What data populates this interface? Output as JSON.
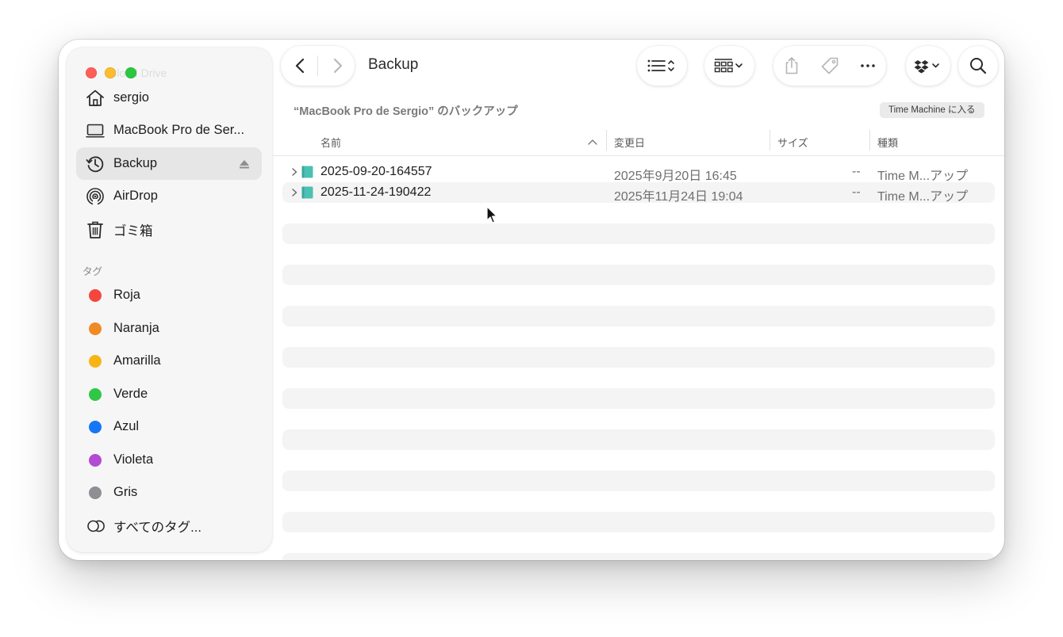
{
  "window": {
    "title": "Backup",
    "ghost_title": "iCloud Drive"
  },
  "sidebar": {
    "items": [
      {
        "label": "sergio",
        "icon": "home-icon"
      },
      {
        "label": "MacBook Pro de Ser...",
        "icon": "laptop-icon"
      },
      {
        "label": "Backup",
        "icon": "time-machine-icon",
        "selected": true
      },
      {
        "label": "AirDrop",
        "icon": "airdrop-icon"
      },
      {
        "label": "ゴミ箱",
        "icon": "trash-icon"
      }
    ],
    "tags_header": "タグ",
    "tags": [
      {
        "label": "Roja",
        "color": "#f5463e"
      },
      {
        "label": "Naranja",
        "color": "#f08a24"
      },
      {
        "label": "Amarilla",
        "color": "#f7b515"
      },
      {
        "label": "Verde",
        "color": "#30c747"
      },
      {
        "label": "Azul",
        "color": "#1776f5"
      },
      {
        "label": "Violeta",
        "color": "#b24cd3"
      },
      {
        "label": "Gris",
        "color": "#8e8e93"
      }
    ],
    "all_tags": "すべてのタグ..."
  },
  "toolbar": {
    "icons": [
      "chevron-left-icon",
      "chevron-right-icon",
      "list-view-icon",
      "group-icon",
      "share-icon",
      "tag-icon",
      "more-icon",
      "dropbox-icon",
      "search-icon"
    ]
  },
  "content": {
    "title": "“MacBook Pro de Sergio” のバックアップ",
    "tm_button": "Time Machine に入る",
    "columns": {
      "name": "名前",
      "date": "変更日",
      "size": "サイズ",
      "kind": "種類"
    },
    "rows": [
      {
        "name": "2025-09-20-164557",
        "date": "2025年9月20日 16:45",
        "size": "--",
        "kind": "Time M...アップ"
      },
      {
        "name": "2025-11-24-190422",
        "date": "2025年11月24日 19:04",
        "size": "--",
        "kind": "Time M...アップ"
      }
    ]
  },
  "colors": {
    "folder": "#4dc0b4",
    "selection": "#e6e6e6",
    "stripe": "#f4f4f5"
  }
}
